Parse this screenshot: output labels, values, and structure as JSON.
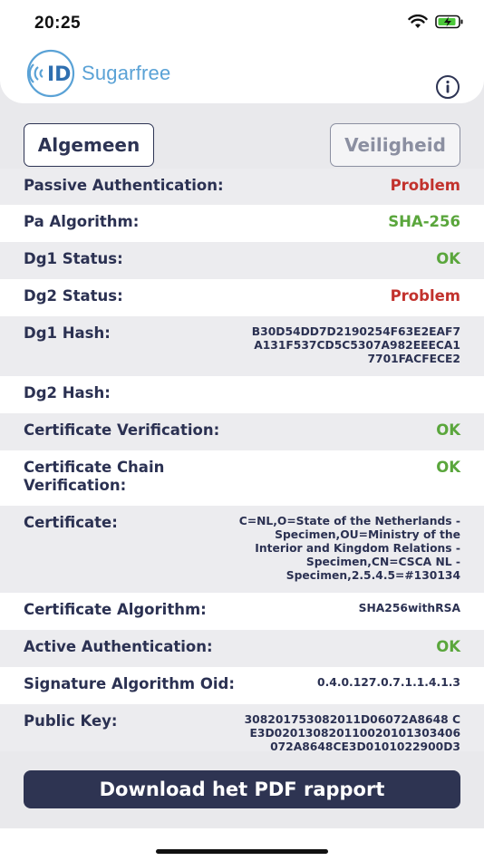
{
  "status_bar": {
    "time": "20:25"
  },
  "header": {
    "logo_mark": "ID",
    "logo_text": "Sugarfree"
  },
  "tabs": [
    {
      "label": "Algemeen",
      "active": true
    },
    {
      "label": "Veiligheid",
      "active": false
    }
  ],
  "rows": [
    {
      "label": "Passive Authentication:",
      "value": "Problem",
      "status": "problem"
    },
    {
      "label": "Pa Algorithm:",
      "value": "SHA-256",
      "status": "ok"
    },
    {
      "label": "Dg1 Status:",
      "value": "OK",
      "status": "ok"
    },
    {
      "label": "Dg2 Status:",
      "value": "Problem",
      "status": "problem"
    },
    {
      "label": "Dg1 Hash:",
      "value": "B30D54DD7D2190254F63E2EAF7 A131F537CD5C5307A982EEECA1 7701FACFECE2",
      "status": "text"
    },
    {
      "label": "Dg2 Hash:",
      "value": "",
      "status": "text"
    },
    {
      "label": "Certificate Verification:",
      "value": "OK",
      "status": "ok"
    },
    {
      "label": "Certificate Chain Verification:",
      "value": "OK",
      "status": "ok"
    },
    {
      "label": "Certificate:",
      "value": "C=NL,O=State of the Netherlands - Specimen,OU=Ministry of the Interior and Kingdom Relations - Specimen,CN=CSCA NL - Specimen,2.5.4.5=#130134",
      "status": "text"
    },
    {
      "label": "Certificate Algorithm:",
      "value": "SHA256withRSA",
      "status": "text"
    },
    {
      "label": "Active Authentication:",
      "value": "OK",
      "status": "ok"
    },
    {
      "label": "Signature Algorithm Oid:",
      "value": "0.4.0.127.0.7.1.1.4.1.3",
      "status": "text"
    },
    {
      "label": "Public Key:",
      "value": "308201753082011D06072A8648 CE3D020130820110020101303406072A8648CE3D0101022900D3",
      "status": "text"
    }
  ],
  "download_button": {
    "label": "Download het PDF rapport"
  },
  "colors": {
    "navy": "#2e3452",
    "ok": "#5aa63c",
    "problem": "#c2322d",
    "brand": "#5aa2d6"
  }
}
